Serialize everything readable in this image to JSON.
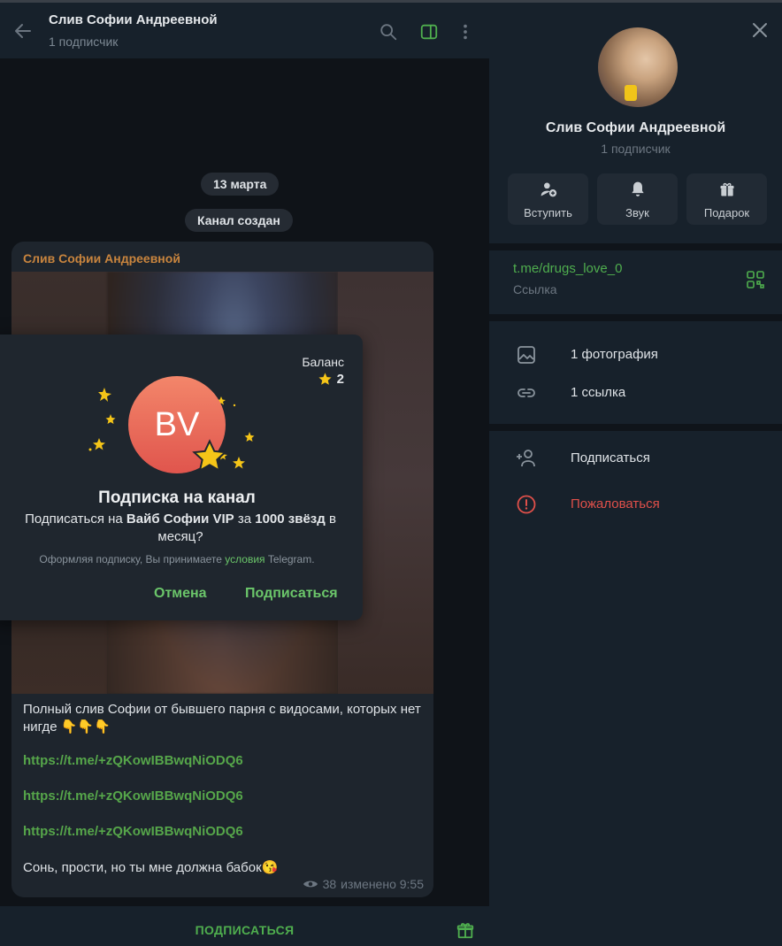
{
  "chat": {
    "title": "Слив Софии Андреевной",
    "subtitle": "1 подписчик",
    "date_pill": "13 марта",
    "service_pill": "Канал создан",
    "message": {
      "author": "Слив Софии Андреевной",
      "text": "Полный слив Софии от бывшего парня с видосами, которых нет нигде 👇👇👇",
      "links": [
        "https://t.me/+zQKowIBBwqNiODQ6",
        "https://t.me/+zQKowIBBwqNiODQ6",
        "https://t.me/+zQKowIBBwqNiODQ6"
      ],
      "last_line": "Сонь, прости, но ты мне должна бабок😘",
      "views": "38",
      "edited": "изменено 9:55"
    },
    "bottom_button": "ПОДПИСАТЬСЯ"
  },
  "modal": {
    "balance_label": "Баланс",
    "balance_value": "2",
    "avatar_initials": "BV",
    "title": "Подписка на канал",
    "desc_prefix": "Подписаться на ",
    "desc_channel": "Вайб Софии VIP",
    "desc_mid": " за ",
    "desc_price": "1000 звёзд",
    "desc_suffix": " в месяц?",
    "terms_prefix": "Оформляя подписку, Вы принимаете ",
    "terms_link": "условия",
    "terms_suffix": " Telegram.",
    "cancel": "Отмена",
    "confirm": "Подписаться"
  },
  "info": {
    "name": "Слив Софии Андреевной",
    "subtitle": "1 подписчик",
    "actions": [
      {
        "label": "Вступить",
        "icon": "add-user-icon"
      },
      {
        "label": "Звук",
        "icon": "bell-icon"
      },
      {
        "label": "Подарок",
        "icon": "gift-icon"
      }
    ],
    "link": "t.me/drugs_love_0",
    "link_caption": "Ссылка",
    "media_rows": [
      {
        "label": "1 фотография",
        "icon": "photo-icon"
      },
      {
        "label": "1 ссылка",
        "icon": "link-icon"
      }
    ],
    "subscribe": "Подписаться",
    "report": "Пожаловаться"
  },
  "colors": {
    "accent_green": "#4fae4e",
    "danger_red": "#e0504a",
    "author_orange": "#c9853e",
    "star_gold": "#f5c518"
  }
}
